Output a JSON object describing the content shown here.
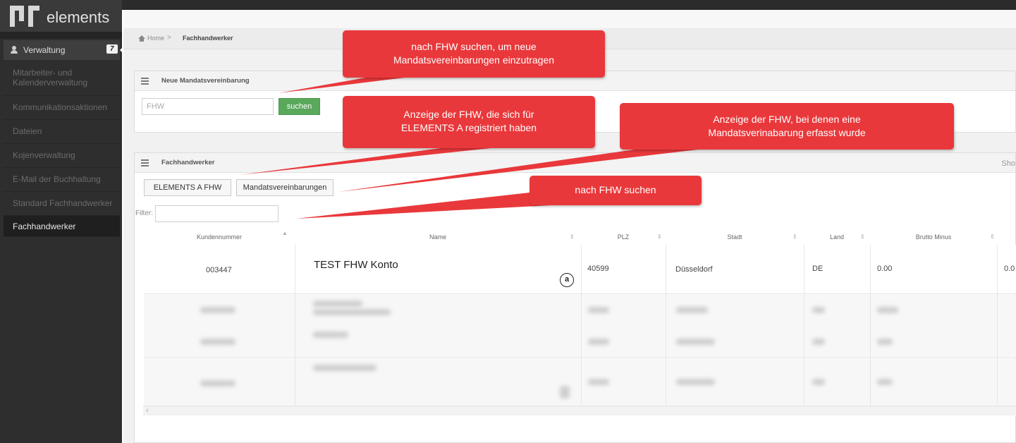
{
  "app": {
    "logo_text": "elements"
  },
  "sidebar": {
    "main_item": {
      "label": "Verwaltung",
      "badge": "7"
    },
    "items": [
      {
        "label": "Mitarbeiter- und Kalenderverwaltung",
        "line1": "Mitarbeiter- und",
        "line2": "Kalenderverwaltung"
      },
      {
        "label": "Kommunikationsaktionen"
      },
      {
        "label": "Dateien"
      },
      {
        "label": "Kojenverwaltung"
      },
      {
        "label": "E-Mail der Buchhaltung"
      },
      {
        "label": "Standard Fachhandwerker"
      },
      {
        "label": "Fachhandwerker",
        "active": true
      }
    ]
  },
  "breadcrumb": {
    "home": "Home",
    "separator": ">",
    "current": "Fachhandwerker"
  },
  "mandate_panel": {
    "title": "Neue Mandatsvereinbarung",
    "input_placeholder": "FHW",
    "search_button": "suchen"
  },
  "fhw_panel": {
    "title": "Fachhandwerker",
    "show_text": "Sho",
    "buttons": {
      "elements_a": "ELEMENTS A FHW",
      "mandates": "Mandatsvereinbarungen"
    },
    "filter_label": "Filter:",
    "table": {
      "columns": [
        "Kundennummer",
        "Name",
        "PLZ",
        "Stadt",
        "Land",
        "Brutto Minus"
      ],
      "rows": [
        {
          "kundennummer": "003447",
          "name": "TEST FHW Konto",
          "plz": "40599",
          "stadt": "Düsseldorf",
          "land": "DE",
          "brutto_minus": "0.00",
          "next": "0.0"
        }
      ],
      "amazon_icon": "a"
    }
  },
  "callouts": {
    "c1": {
      "line1": "nach FHW suchen, um neue",
      "line2": "Mandatsvereinbarungen einzutragen"
    },
    "c2": {
      "line1": "Anzeige der FHW, die sich für",
      "line2": "ELEMENTS A registriert haben"
    },
    "c3": {
      "line1": "Anzeige der FHW, bei denen eine",
      "line2": "Mandatsverinabarung erfasst wurde"
    },
    "c4": {
      "line1": "nach FHW suchen"
    }
  },
  "colors": {
    "callout": "#e9383b",
    "sidebar": "#2e2e2e",
    "search_button": "#5aa85c"
  }
}
